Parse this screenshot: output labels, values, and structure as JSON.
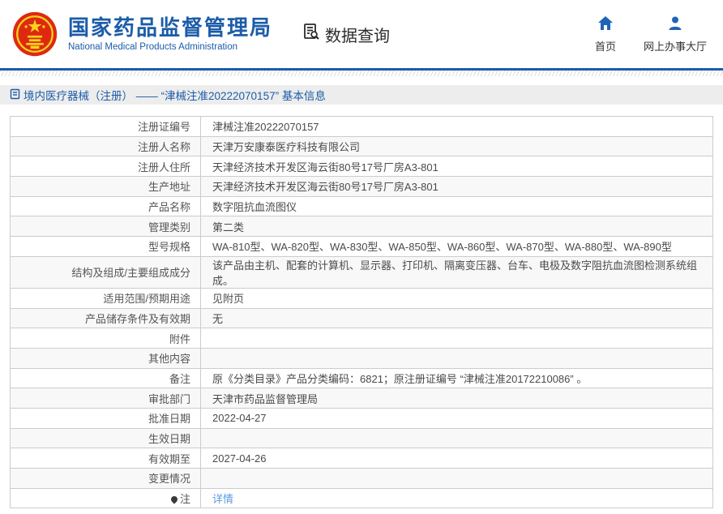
{
  "header": {
    "org_name_zh": "国家药品监督管理局",
    "org_name_en": "National Medical Products Administration",
    "section_title": "数据查询",
    "nav": [
      {
        "label": "首页",
        "icon": "home-icon"
      },
      {
        "label": "网上办事大厅",
        "icon": "person-icon"
      }
    ]
  },
  "breadcrumb": {
    "text": "境内医疗器械（注册） —— “津械注准20222070157” 基本信息"
  },
  "table": {
    "rows": [
      {
        "label": "注册证编号",
        "value": "津械注准20222070157"
      },
      {
        "label": "注册人名称",
        "value": "天津万安康泰医疗科技有限公司"
      },
      {
        "label": "注册人住所",
        "value": "天津经济技术开发区海云街80号17号厂房A3-801"
      },
      {
        "label": "生产地址",
        "value": "天津经济技术开发区海云街80号17号厂房A3-801"
      },
      {
        "label": "产品名称",
        "value": "数字阻抗血流图仪"
      },
      {
        "label": "管理类别",
        "value": "第二类"
      },
      {
        "label": "型号规格",
        "value": "WA-810型、WA-820型、WA-830型、WA-850型、WA-860型、WA-870型、WA-880型、WA-890型"
      },
      {
        "label": "结构及组成/主要组成成分",
        "value": "该产品由主机、配套的计算机、显示器、打印机、隔离变压器、台车、电极及数字阻抗血流图检测系统组成。"
      },
      {
        "label": "适用范围/预期用途",
        "value": "见附页"
      },
      {
        "label": "产品储存条件及有效期",
        "value": "无"
      },
      {
        "label": "附件",
        "value": ""
      },
      {
        "label": "其他内容",
        "value": ""
      },
      {
        "label": "备注",
        "value": "原《分类目录》产品分类编码：6821；原注册证编号 “津械注准20172210086” 。"
      },
      {
        "label": "审批部门",
        "value": "天津市药品监督管理局"
      },
      {
        "label": "批准日期",
        "value": "2022-04-27"
      },
      {
        "label": "生效日期",
        "value": ""
      },
      {
        "label": "有效期至",
        "value": "2027-04-26"
      },
      {
        "label": "变更情况",
        "value": ""
      },
      {
        "label": "注",
        "value": "详情",
        "link": true,
        "icon": "note-icon"
      }
    ]
  },
  "colors": {
    "brand_blue": "#1c5ca8",
    "icon_blue": "#1e63b8",
    "link_blue": "#5b9be1",
    "emblem_red": "#de2910",
    "emblem_gold": "#f7d21e",
    "border_gray": "#cccccc",
    "row_alt_gray": "#f8f8f8",
    "breadcrumb_bg": "#ededed"
  }
}
